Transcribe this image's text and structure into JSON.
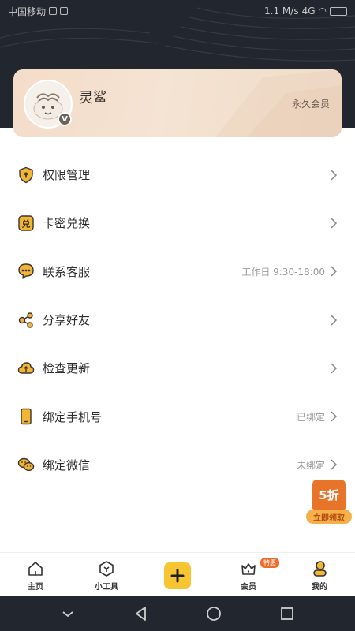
{
  "status_bar": {
    "carrier": "中国移动",
    "speed": "1.1 M/s",
    "network": "4G"
  },
  "profile": {
    "username": "灵鲨",
    "membership": "永久会员",
    "badge": "V"
  },
  "menu": [
    {
      "label": "权限管理",
      "value": "",
      "icon": "shield-icon",
      "name": "permission-management"
    },
    {
      "label": "卡密兑换",
      "value": "",
      "icon": "redeem-icon",
      "name": "card-redeem"
    },
    {
      "label": "联系客服",
      "value": "工作日 9:30-18:00",
      "icon": "chat-bubble-icon",
      "name": "contact-service"
    },
    {
      "label": "分享好友",
      "value": "",
      "icon": "share-icon",
      "name": "share-friends"
    },
    {
      "label": "检查更新",
      "value": "",
      "icon": "cloud-upload-icon",
      "name": "check-update"
    },
    {
      "label": "绑定手机号",
      "value": "已绑定",
      "icon": "phone-icon",
      "name": "bind-phone"
    },
    {
      "label": "绑定微信",
      "value": "未绑定",
      "icon": "wechat-icon",
      "name": "bind-wechat"
    }
  ],
  "promo": {
    "discount": "5折",
    "action": "立即领取"
  },
  "tabs": [
    {
      "label": "主页",
      "icon": "home-icon"
    },
    {
      "label": "小工具",
      "icon": "tools-icon"
    },
    {
      "label": "",
      "icon": "plus-icon"
    },
    {
      "label": "会员",
      "icon": "crown-icon",
      "badge": "特惠"
    },
    {
      "label": "我的",
      "icon": "profile-icon"
    }
  ],
  "colors": {
    "accent": "#f7c531",
    "icon_fill": "#f2b632",
    "header_bg": "#22262e",
    "promo_orange": "#e8742a"
  }
}
